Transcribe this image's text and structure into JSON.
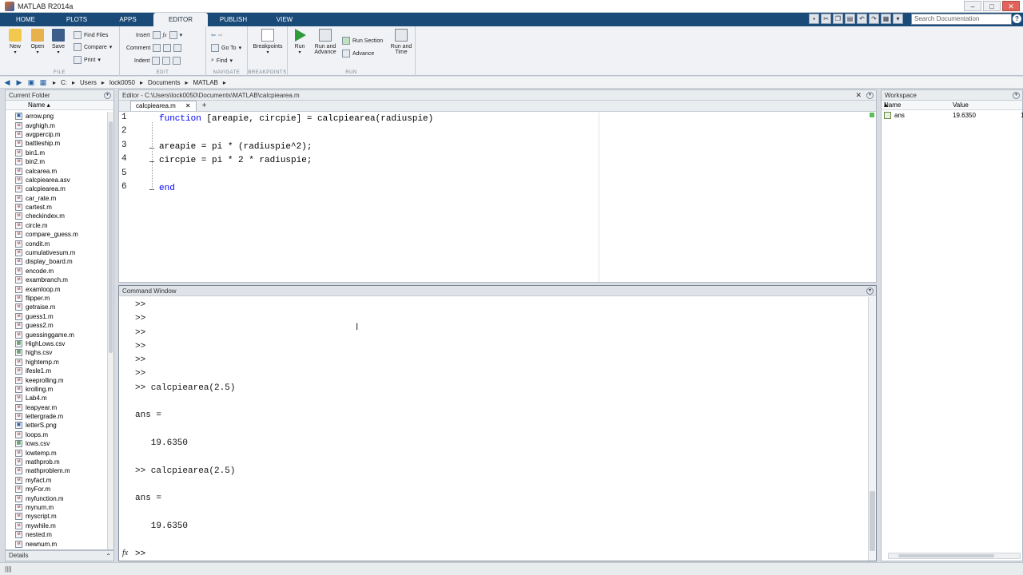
{
  "window": {
    "title": "MATLAB R2014a"
  },
  "tabs": [
    "HOME",
    "PLOTS",
    "APPS",
    "EDITOR",
    "PUBLISH",
    "VIEW"
  ],
  "active_tab": "EDITOR",
  "search": {
    "placeholder": "Search Documentation"
  },
  "ribbon": {
    "file": {
      "label": "FILE",
      "new": "New",
      "open": "Open",
      "save": "Save",
      "find_files": "Find Files",
      "compare": "Compare",
      "print": "Print"
    },
    "edit": {
      "label": "EDIT",
      "insert": "Insert",
      "comment": "Comment",
      "indent": "Indent"
    },
    "navigate": {
      "label": "NAVIGATE",
      "go_to": "Go To",
      "find": "Find"
    },
    "breakpoints": {
      "label": "BREAKPOINTS",
      "breakpoints": "Breakpoints"
    },
    "run": {
      "label": "RUN",
      "run": "Run",
      "run_and_advance_1": "Run and",
      "run_and_advance_2": "Advance",
      "run_section": "Run Section",
      "advance": "Advance",
      "run_and_time_1": "Run and",
      "run_and_time_2": "Time"
    }
  },
  "address": {
    "drive": "C:",
    "parts": [
      "Users",
      "lock0050",
      "Documents",
      "MATLAB"
    ]
  },
  "current_folder": {
    "title": "Current Folder",
    "column": "Name",
    "files": [
      {
        "name": "arrow.png",
        "type": "img"
      },
      {
        "name": "avghigh.m",
        "type": "m"
      },
      {
        "name": "avgpercip.m",
        "type": "m"
      },
      {
        "name": "battleship.m",
        "type": "m"
      },
      {
        "name": "bin1.m",
        "type": "m"
      },
      {
        "name": "bin2.m",
        "type": "m"
      },
      {
        "name": "calcarea.m",
        "type": "m"
      },
      {
        "name": "calcpiearea.asv",
        "type": "m"
      },
      {
        "name": "calcpiearea.m",
        "type": "m"
      },
      {
        "name": "car_rate.m",
        "type": "m"
      },
      {
        "name": "cartest.m",
        "type": "m"
      },
      {
        "name": "checkindex.m",
        "type": "m"
      },
      {
        "name": "circle.m",
        "type": "m"
      },
      {
        "name": "compare_guess.m",
        "type": "m"
      },
      {
        "name": "condit.m",
        "type": "m"
      },
      {
        "name": "cumulativesum.m",
        "type": "m"
      },
      {
        "name": "display_board.m",
        "type": "m"
      },
      {
        "name": "encode.m",
        "type": "m"
      },
      {
        "name": "exambranch.m",
        "type": "m"
      },
      {
        "name": "examloop.m",
        "type": "m"
      },
      {
        "name": "flipper.m",
        "type": "m"
      },
      {
        "name": "getraise.m",
        "type": "m"
      },
      {
        "name": "guess1.m",
        "type": "m"
      },
      {
        "name": "guess2.m",
        "type": "m"
      },
      {
        "name": "guessinggame.m",
        "type": "m"
      },
      {
        "name": "HighLows.csv",
        "type": "csv"
      },
      {
        "name": "highs.csv",
        "type": "csv"
      },
      {
        "name": "hightemp.m",
        "type": "m"
      },
      {
        "name": "ifesle1.m",
        "type": "m"
      },
      {
        "name": "keeprolling.m",
        "type": "m"
      },
      {
        "name": "krolling.m",
        "type": "m"
      },
      {
        "name": "Lab4.m",
        "type": "m"
      },
      {
        "name": "leapyear.m",
        "type": "m"
      },
      {
        "name": "lettergrade.m",
        "type": "m"
      },
      {
        "name": "letterS.png",
        "type": "img"
      },
      {
        "name": "loops.m",
        "type": "m"
      },
      {
        "name": "lows.csv",
        "type": "csv"
      },
      {
        "name": "lowtemp.m",
        "type": "m"
      },
      {
        "name": "mathprob.m",
        "type": "m"
      },
      {
        "name": "mathproblem.m",
        "type": "m"
      },
      {
        "name": "myfact.m",
        "type": "m"
      },
      {
        "name": "myFor.m",
        "type": "m"
      },
      {
        "name": "myfunction.m",
        "type": "m"
      },
      {
        "name": "mynum.m",
        "type": "m"
      },
      {
        "name": "myscript.m",
        "type": "m"
      },
      {
        "name": "mywhile.m",
        "type": "m"
      },
      {
        "name": "nested.m",
        "type": "m"
      },
      {
        "name": "newnum.m",
        "type": "m"
      }
    ],
    "details_label": "Details"
  },
  "editor": {
    "title": "Editor - C:\\Users\\lock0050\\Documents\\MATLAB\\calcpiearea.m",
    "tab": "calcpiearea.m",
    "lines": [
      {
        "num": "1",
        "kw": "function",
        "text": " [areapie, circpie] = calcpiearea(radiuspie)",
        "indent": 0,
        "dash": false
      },
      {
        "num": "2",
        "kw": "",
        "text": "",
        "indent": 0,
        "dash": false
      },
      {
        "num": "3",
        "kw": "",
        "text": "areapie = pi * (radiuspie^2);",
        "indent": 0,
        "dash": true
      },
      {
        "num": "4",
        "kw": "",
        "text": "circpie = pi * 2 * radiuspie;",
        "indent": 0,
        "dash": true
      },
      {
        "num": "5",
        "kw": "",
        "text": "",
        "indent": 0,
        "dash": false
      },
      {
        "num": "6",
        "kw": "end",
        "text": "",
        "indent": 0,
        "dash": true
      }
    ]
  },
  "command_window": {
    "title": "Command Window",
    "lines": [
      ">>",
      ">>",
      ">>",
      ">>",
      ">>",
      ">>",
      ">> calcpiearea(2.5)",
      "",
      "ans =",
      "",
      "   19.6350",
      "",
      ">> calcpiearea(2.5)",
      "",
      "ans =",
      "",
      "   19.6350"
    ],
    "fx": "fx",
    "prompt": ">>"
  },
  "workspace": {
    "title": "Workspace",
    "columns": [
      "Name",
      "Value"
    ],
    "vars": [
      {
        "name": "ans",
        "value": "19.6350",
        "extra": "1"
      }
    ]
  },
  "status": "||||"
}
